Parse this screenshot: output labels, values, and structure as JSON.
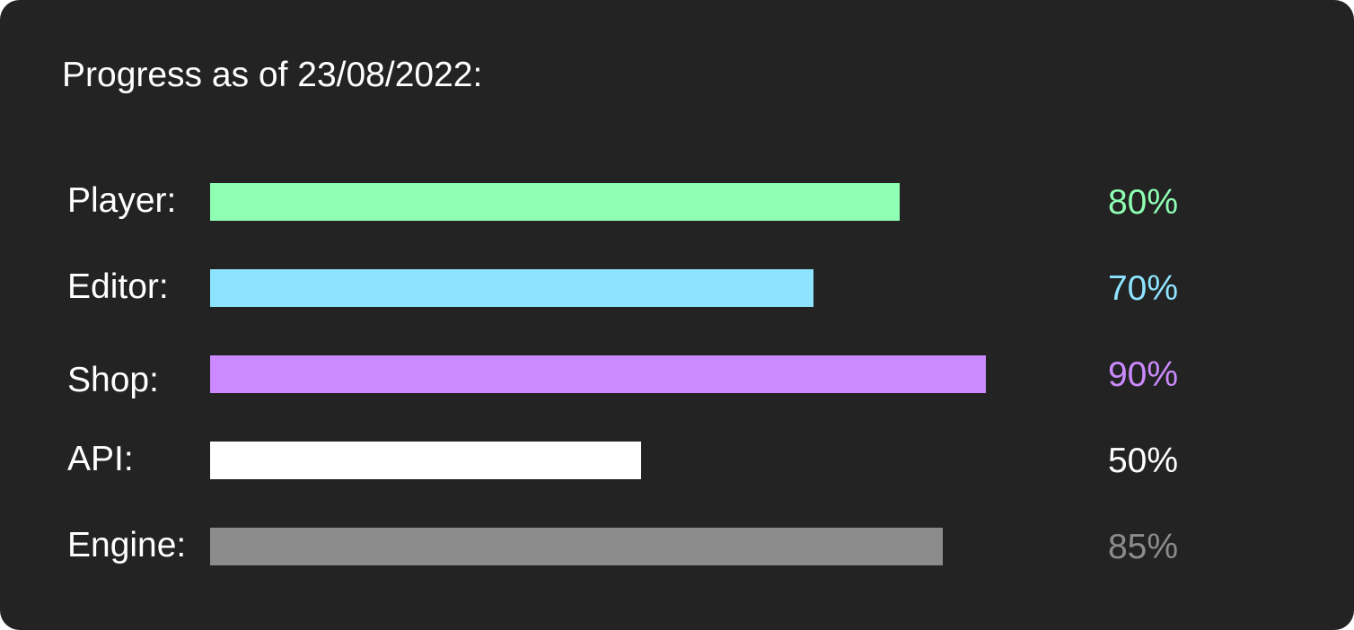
{
  "header": {
    "title": "Progress as of 23/08/2022:"
  },
  "chart_data": {
    "type": "bar",
    "orientation": "horizontal",
    "title": "Progress as of 23/08/2022:",
    "xlim": [
      0,
      100
    ],
    "grid": false,
    "categories": [
      "Player:",
      "Editor:",
      "Shop:",
      "API:",
      "Engine:"
    ],
    "values": [
      80,
      70,
      90,
      50,
      85
    ],
    "value_labels": [
      "80%",
      "70%",
      "90%",
      "50%",
      "85%"
    ],
    "colors": [
      "#8effb3",
      "#8ee3ff",
      "#cb8aff",
      "#ffffff",
      "#8c8c8c"
    ]
  }
}
